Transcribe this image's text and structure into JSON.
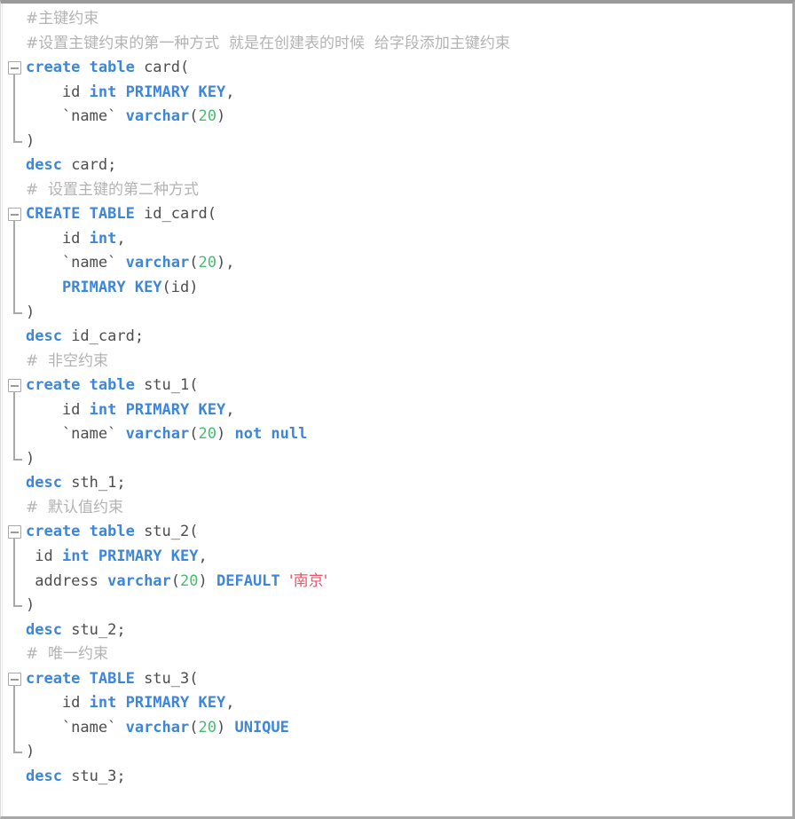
{
  "editor": {
    "language": "sql",
    "colors": {
      "background": "#ffffff",
      "keyword": "#3d86d8",
      "number": "#45bd70",
      "string": "#e8536b",
      "comment": "#b3b3b3",
      "plain": "#4d4d4d",
      "fold_marker": "#a9a9a9"
    },
    "fold_icon": "fold-collapse-minus-icon",
    "lines": [
      {
        "n": 1,
        "fold": "none",
        "tokens": [
          {
            "t": "comment",
            "v": "#主键约束",
            "cjk": true
          }
        ]
      },
      {
        "n": 2,
        "fold": "none",
        "tokens": [
          {
            "t": "comment",
            "v": "#设置主键约束的第一种方式  就是在创建表的时候  给字段添加主键约束",
            "cjk": true
          }
        ]
      },
      {
        "n": 3,
        "fold": "start",
        "tokens": [
          {
            "t": "kw",
            "v": "create table"
          },
          {
            "t": "plain",
            "v": " card("
          }
        ]
      },
      {
        "n": 4,
        "fold": "mid",
        "tokens": [
          {
            "t": "plain",
            "v": "    id "
          },
          {
            "t": "kw",
            "v": "int PRIMARY KEY"
          },
          {
            "t": "plain",
            "v": ","
          }
        ]
      },
      {
        "n": 5,
        "fold": "mid",
        "tokens": [
          {
            "t": "plain",
            "v": "    `name` "
          },
          {
            "t": "kw",
            "v": "varchar"
          },
          {
            "t": "plain",
            "v": "("
          },
          {
            "t": "num",
            "v": "20"
          },
          {
            "t": "plain",
            "v": ")"
          }
        ]
      },
      {
        "n": 6,
        "fold": "end",
        "tokens": [
          {
            "t": "plain",
            "v": ")"
          }
        ]
      },
      {
        "n": 7,
        "fold": "none",
        "tokens": [
          {
            "t": "kw",
            "v": "desc"
          },
          {
            "t": "plain",
            "v": " card;"
          }
        ]
      },
      {
        "n": 8,
        "fold": "none",
        "tokens": [
          {
            "t": "comment",
            "v": "#  设置主键的第二种方式",
            "cjk": true
          }
        ]
      },
      {
        "n": 9,
        "fold": "start",
        "tokens": [
          {
            "t": "kw",
            "v": "CREATE TABLE"
          },
          {
            "t": "plain",
            "v": " id_card("
          }
        ]
      },
      {
        "n": 10,
        "fold": "mid",
        "tokens": [
          {
            "t": "plain",
            "v": "    id "
          },
          {
            "t": "kw",
            "v": "int"
          },
          {
            "t": "plain",
            "v": ","
          }
        ]
      },
      {
        "n": 11,
        "fold": "mid",
        "tokens": [
          {
            "t": "plain",
            "v": "    `name` "
          },
          {
            "t": "kw",
            "v": "varchar"
          },
          {
            "t": "plain",
            "v": "("
          },
          {
            "t": "num",
            "v": "20"
          },
          {
            "t": "plain",
            "v": "),"
          }
        ]
      },
      {
        "n": 12,
        "fold": "mid",
        "tokens": [
          {
            "t": "plain",
            "v": "    "
          },
          {
            "t": "kw",
            "v": "PRIMARY KEY"
          },
          {
            "t": "plain",
            "v": "(id)"
          }
        ]
      },
      {
        "n": 13,
        "fold": "end",
        "tokens": [
          {
            "t": "plain",
            "v": ")"
          }
        ]
      },
      {
        "n": 14,
        "fold": "none",
        "tokens": [
          {
            "t": "kw",
            "v": "desc"
          },
          {
            "t": "plain",
            "v": " id_card;"
          }
        ]
      },
      {
        "n": 15,
        "fold": "none",
        "tokens": [
          {
            "t": "comment",
            "v": "#  非空约束",
            "cjk": true
          }
        ]
      },
      {
        "n": 16,
        "fold": "start",
        "tokens": [
          {
            "t": "kw",
            "v": "create table"
          },
          {
            "t": "plain",
            "v": " stu_1("
          }
        ]
      },
      {
        "n": 17,
        "fold": "mid",
        "tokens": [
          {
            "t": "plain",
            "v": "    id "
          },
          {
            "t": "kw",
            "v": "int PRIMARY KEY"
          },
          {
            "t": "plain",
            "v": ","
          }
        ]
      },
      {
        "n": 18,
        "fold": "mid",
        "tokens": [
          {
            "t": "plain",
            "v": "    `name` "
          },
          {
            "t": "kw",
            "v": "varchar"
          },
          {
            "t": "plain",
            "v": "("
          },
          {
            "t": "num",
            "v": "20"
          },
          {
            "t": "plain",
            "v": ") "
          },
          {
            "t": "kw",
            "v": "not null"
          }
        ]
      },
      {
        "n": 19,
        "fold": "end",
        "tokens": [
          {
            "t": "plain",
            "v": ")"
          }
        ]
      },
      {
        "n": 20,
        "fold": "none",
        "tokens": [
          {
            "t": "kw",
            "v": "desc"
          },
          {
            "t": "plain",
            "v": " sth_1;"
          }
        ]
      },
      {
        "n": 21,
        "fold": "none",
        "tokens": [
          {
            "t": "comment",
            "v": "#  默认值约束",
            "cjk": true
          }
        ]
      },
      {
        "n": 22,
        "fold": "start",
        "tokens": [
          {
            "t": "kw",
            "v": "create table"
          },
          {
            "t": "plain",
            "v": " stu_2("
          }
        ]
      },
      {
        "n": 23,
        "fold": "mid",
        "tokens": [
          {
            "t": "plain",
            "v": " id "
          },
          {
            "t": "kw",
            "v": "int PRIMARY KEY"
          },
          {
            "t": "plain",
            "v": ","
          }
        ]
      },
      {
        "n": 24,
        "fold": "mid",
        "tokens": [
          {
            "t": "plain",
            "v": " address "
          },
          {
            "t": "kw",
            "v": "varchar"
          },
          {
            "t": "plain",
            "v": "("
          },
          {
            "t": "num",
            "v": "20"
          },
          {
            "t": "plain",
            "v": ") "
          },
          {
            "t": "kw",
            "v": "DEFAULT"
          },
          {
            "t": "plain",
            "v": " "
          },
          {
            "t": "str",
            "v": "'南京'",
            "cjk": true
          }
        ]
      },
      {
        "n": 25,
        "fold": "end",
        "tokens": [
          {
            "t": "plain",
            "v": ")"
          }
        ]
      },
      {
        "n": 26,
        "fold": "none",
        "tokens": [
          {
            "t": "kw",
            "v": "desc"
          },
          {
            "t": "plain",
            "v": " stu_2;"
          }
        ]
      },
      {
        "n": 27,
        "fold": "none",
        "tokens": [
          {
            "t": "comment",
            "v": "#  唯一约束",
            "cjk": true
          }
        ]
      },
      {
        "n": 28,
        "fold": "start",
        "tokens": [
          {
            "t": "kw",
            "v": "create TABLE"
          },
          {
            "t": "plain",
            "v": " stu_3("
          }
        ]
      },
      {
        "n": 29,
        "fold": "mid",
        "tokens": [
          {
            "t": "plain",
            "v": "    id "
          },
          {
            "t": "kw",
            "v": "int PRIMARY KEY"
          },
          {
            "t": "plain",
            "v": ","
          }
        ]
      },
      {
        "n": 30,
        "fold": "mid",
        "tokens": [
          {
            "t": "plain",
            "v": "    `name` "
          },
          {
            "t": "kw",
            "v": "varchar"
          },
          {
            "t": "plain",
            "v": "("
          },
          {
            "t": "num",
            "v": "20"
          },
          {
            "t": "plain",
            "v": ") "
          },
          {
            "t": "kw",
            "v": "UNIQUE"
          }
        ]
      },
      {
        "n": 31,
        "fold": "end",
        "tokens": [
          {
            "t": "plain",
            "v": ")"
          }
        ]
      },
      {
        "n": 32,
        "fold": "none",
        "tokens": [
          {
            "t": "kw",
            "v": "desc"
          },
          {
            "t": "plain",
            "v": " stu_3;"
          }
        ]
      }
    ]
  }
}
